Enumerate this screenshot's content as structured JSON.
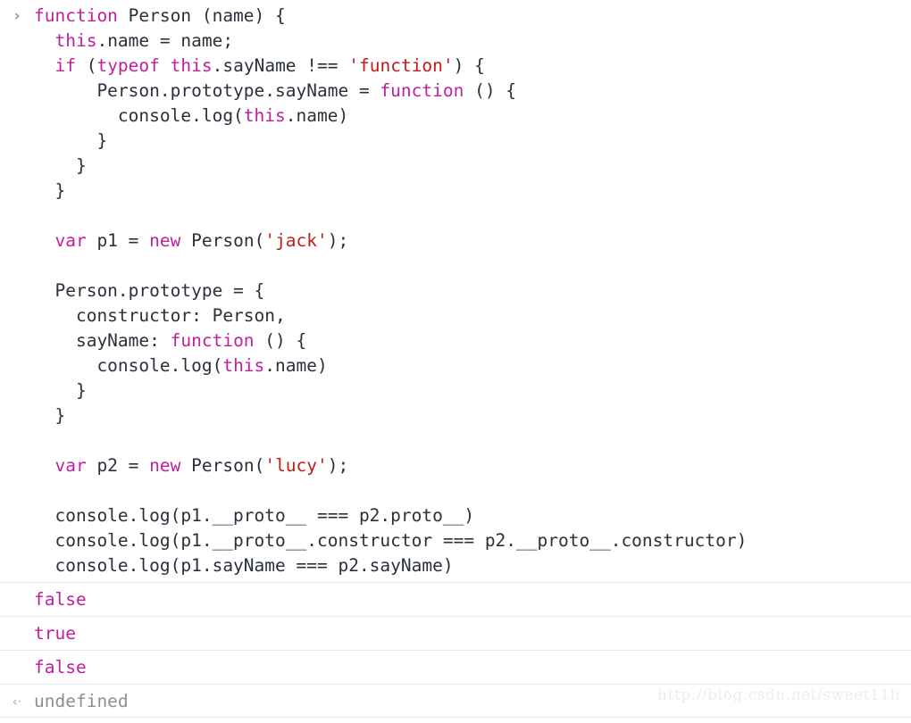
{
  "console": {
    "prompt_marker": "›",
    "result_marker": "‹·",
    "input_lines": [
      [
        {
          "t": "function",
          "c": "kw"
        },
        {
          "t": " Person (name) {",
          "c": "plain"
        }
      ],
      [
        {
          "t": "  ",
          "c": "plain"
        },
        {
          "t": "this",
          "c": "kw"
        },
        {
          "t": ".name = name;",
          "c": "plain"
        }
      ],
      [
        {
          "t": "  ",
          "c": "plain"
        },
        {
          "t": "if",
          "c": "kw"
        },
        {
          "t": " (",
          "c": "plain"
        },
        {
          "t": "typeof",
          "c": "kw"
        },
        {
          "t": " ",
          "c": "plain"
        },
        {
          "t": "this",
          "c": "kw"
        },
        {
          "t": ".sayName !== ",
          "c": "plain"
        },
        {
          "t": "'function'",
          "c": "str"
        },
        {
          "t": ") {",
          "c": "plain"
        }
      ],
      [
        {
          "t": "      Person.prototype.sayName = ",
          "c": "plain"
        },
        {
          "t": "function",
          "c": "kw"
        },
        {
          "t": " () {",
          "c": "plain"
        }
      ],
      [
        {
          "t": "        console.log(",
          "c": "plain"
        },
        {
          "t": "this",
          "c": "kw"
        },
        {
          "t": ".name)",
          "c": "plain"
        }
      ],
      [
        {
          "t": "      }",
          "c": "plain"
        }
      ],
      [
        {
          "t": "    }",
          "c": "plain"
        }
      ],
      [
        {
          "t": "  }",
          "c": "plain"
        }
      ],
      [
        {
          "t": " ",
          "c": "plain"
        }
      ],
      [
        {
          "t": "  ",
          "c": "plain"
        },
        {
          "t": "var",
          "c": "kw"
        },
        {
          "t": " p1 = ",
          "c": "plain"
        },
        {
          "t": "new",
          "c": "kw"
        },
        {
          "t": " Person(",
          "c": "plain"
        },
        {
          "t": "'jack'",
          "c": "str"
        },
        {
          "t": ");",
          "c": "plain"
        }
      ],
      [
        {
          "t": " ",
          "c": "plain"
        }
      ],
      [
        {
          "t": "  Person.prototype = {",
          "c": "plain"
        }
      ],
      [
        {
          "t": "    constructor: Person,",
          "c": "plain"
        }
      ],
      [
        {
          "t": "    sayName: ",
          "c": "plain"
        },
        {
          "t": "function",
          "c": "kw"
        },
        {
          "t": " () {",
          "c": "plain"
        }
      ],
      [
        {
          "t": "      console.log(",
          "c": "plain"
        },
        {
          "t": "this",
          "c": "kw"
        },
        {
          "t": ".name)",
          "c": "plain"
        }
      ],
      [
        {
          "t": "    }",
          "c": "plain"
        }
      ],
      [
        {
          "t": "  }",
          "c": "plain"
        }
      ],
      [
        {
          "t": " ",
          "c": "plain"
        }
      ],
      [
        {
          "t": "  ",
          "c": "plain"
        },
        {
          "t": "var",
          "c": "kw"
        },
        {
          "t": " p2 = ",
          "c": "plain"
        },
        {
          "t": "new",
          "c": "kw"
        },
        {
          "t": " Person(",
          "c": "plain"
        },
        {
          "t": "'lucy'",
          "c": "str"
        },
        {
          "t": ");",
          "c": "plain"
        }
      ],
      [
        {
          "t": " ",
          "c": "plain"
        }
      ],
      [
        {
          "t": "  console.log(p1.__proto__ === p2.proto__)",
          "c": "plain"
        }
      ],
      [
        {
          "t": "  console.log(p1.__proto__.constructor === p2.__proto__.constructor)",
          "c": "plain"
        }
      ],
      [
        {
          "t": "  console.log(p1.sayName === p2.sayName)",
          "c": "plain"
        }
      ]
    ],
    "output_rows": [
      {
        "text": "false",
        "kind": "log"
      },
      {
        "text": "true",
        "kind": "log"
      },
      {
        "text": "false",
        "kind": "log"
      },
      {
        "text": "undefined",
        "kind": "result"
      }
    ],
    "watermark": "http://blog.csdn.net/sweet11h",
    "colors": {
      "keyword": "#c0209c",
      "string": "#c41a16",
      "code_text": "#2a313c",
      "result_text": "#8a9099",
      "separator": "#e8e8e8",
      "background": "#ffffff",
      "watermark": "#ededed"
    }
  }
}
